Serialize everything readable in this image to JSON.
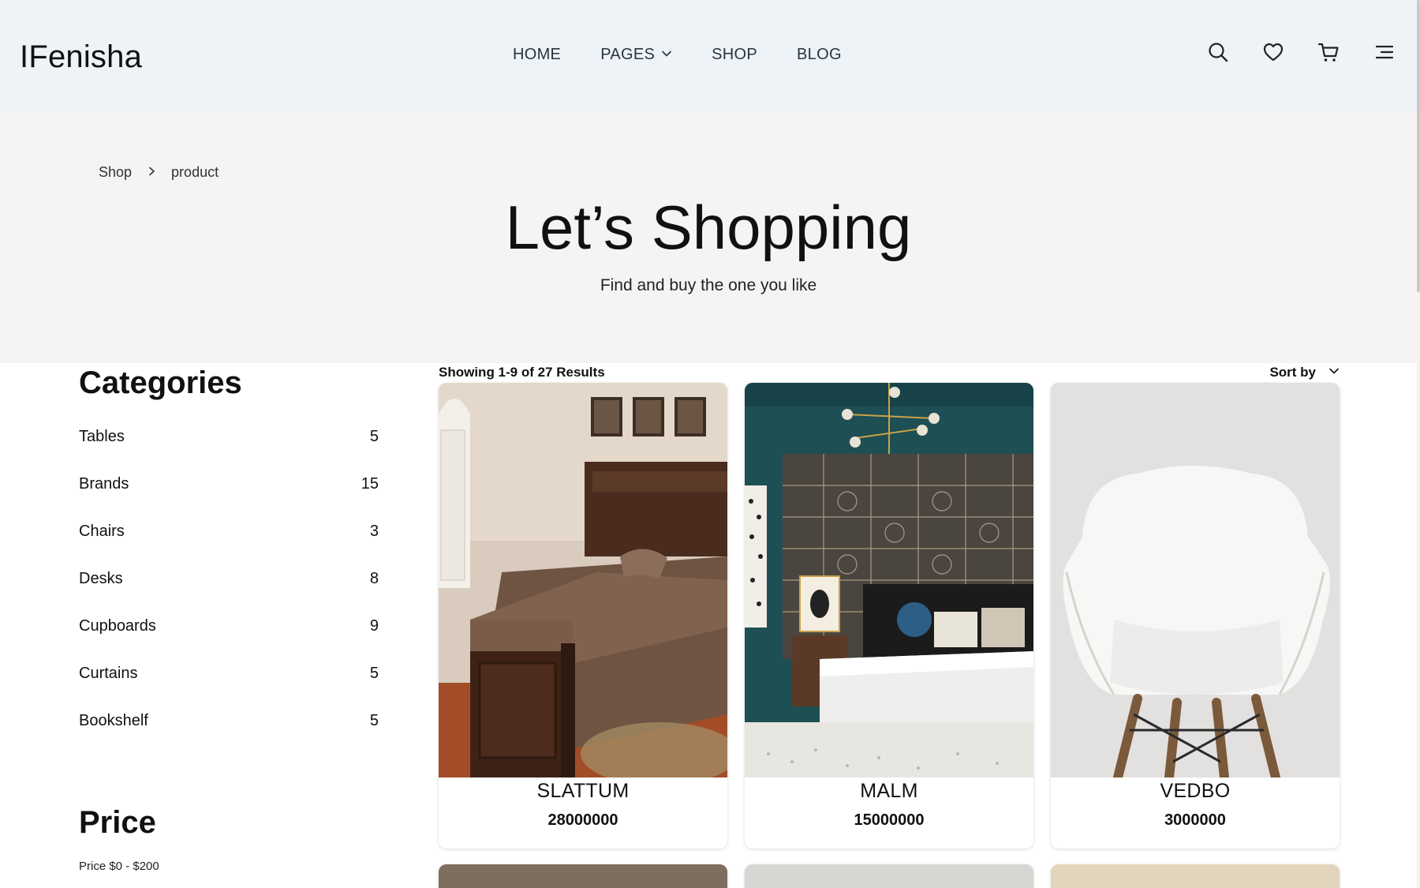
{
  "header": {
    "logo": "IFenisha",
    "nav": [
      {
        "label": "HOME"
      },
      {
        "label": "PAGES"
      },
      {
        "label": "SHOP"
      },
      {
        "label": "BLOG"
      }
    ],
    "icons": [
      "search-icon",
      "heart-icon",
      "cart-icon",
      "menu-icon"
    ]
  },
  "hero": {
    "breadcrumb": [
      "Shop",
      "product"
    ],
    "title": "Let’s Shopping",
    "subtitle": "Find and buy the one you like"
  },
  "sidebar": {
    "categories_title": "Categories",
    "categories": [
      {
        "name": "Tables",
        "count": "5"
      },
      {
        "name": "Brands",
        "count": "15"
      },
      {
        "name": "Chairs",
        "count": "3"
      },
      {
        "name": "Desks",
        "count": "8"
      },
      {
        "name": "Cupboards",
        "count": "9"
      },
      {
        "name": "Curtains",
        "count": "5"
      },
      {
        "name": "Bookshelf",
        "count": "5"
      }
    ],
    "price_title": "Price",
    "price_label": "Price $0 - $200"
  },
  "results": {
    "summary": "Showing 1-9 of 27 Results",
    "sort_label": "Sort by"
  },
  "products": [
    {
      "name": "SLATTUM",
      "price": "28000000"
    },
    {
      "name": "MALM",
      "price": "15000000"
    },
    {
      "name": "VEDBO",
      "price": "3000000"
    }
  ],
  "colors": {
    "header_bg": "#eef3f8",
    "hero_bg": "#f4f4f5",
    "slider_fill": "#3d6ebf"
  }
}
